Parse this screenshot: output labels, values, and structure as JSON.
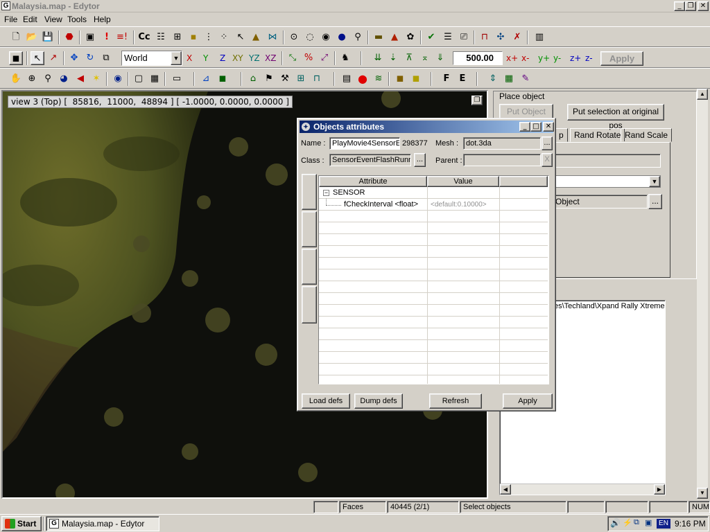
{
  "window": {
    "title": "Malaysia.map - Edytor"
  },
  "menu": [
    "File",
    "Edit",
    "View",
    "Tools",
    "Help"
  ],
  "toolbar1": {
    "cc_label": "Cc",
    "icons": [
      "new-icon",
      "open-icon",
      "save-icon",
      "stop-icon",
      "cube-icon",
      "warning-icon",
      "warning-list-icon",
      "rename-icon",
      "script-icon",
      "script-edit-icon",
      "group-icon",
      "ungroup-icon",
      "ungroup-all-icon",
      "select-arrow-icon",
      "warning-triangle-icon",
      "tree-icon",
      "path-icon",
      "ellipse-icon",
      "eye-icon",
      "eye-solid-icon",
      "pin-icon",
      "book-icon",
      "drop-icon",
      "flower-icon",
      "check-icon",
      "list-icon",
      "camera-icon",
      "gate-icon",
      "tool-icon",
      "tick-icon",
      "film-icon"
    ]
  },
  "toolbar2": {
    "coord_space": "World",
    "axes": [
      "X",
      "Y",
      "Z",
      "XY",
      "YZ",
      "XZ"
    ],
    "step_value": "500.00",
    "step_axes": [
      "x+",
      "x-",
      "y+",
      "y-",
      "z+",
      "z-"
    ],
    "apply_label": "Apply"
  },
  "toolbar3": {
    "letters": [
      "F",
      "E"
    ]
  },
  "viewport": {
    "label": "view 3 (Top) [  85816,  11000,  48894 ] [ -1.0000, 0.0000, 0.0000 ]"
  },
  "right_panel": {
    "group_label": "Place object",
    "put_object": "Put Object",
    "put_selection": "Put selection at original pos",
    "tabs": [
      "p",
      "Rand Rotate",
      "Rand Scale"
    ],
    "object_label": "Object",
    "path_text": "es\\Techland\\Xpand Rally Xtreme"
  },
  "dialog": {
    "title": "Objects attributes",
    "name_label": "Name :",
    "name_value": "PlayMovie4SensorE",
    "name_id": "298377",
    "mesh_label": "Mesh :",
    "mesh_value": "dot.3da",
    "class_label": "Class :",
    "class_value": "SensorEventFlashRunn",
    "parent_label": "Parent :",
    "parent_value": "",
    "browse": "...",
    "clear": "X",
    "columns": [
      "Attribute",
      "Value"
    ],
    "rows": [
      {
        "attr": "SENSOR",
        "value": "",
        "expand": "−"
      },
      {
        "attr": "fCheckInterval <float>",
        "value": "<default:0.10000>"
      }
    ],
    "buttons": {
      "load": "Load defs",
      "dump": "Dump defs",
      "refresh": "Refresh",
      "apply": "Apply"
    }
  },
  "statusbar": {
    "faces_label": "Faces",
    "faces_value": "40445  (2/1)",
    "mode": "Select objects",
    "num": "NUM"
  },
  "taskbar": {
    "start": "Start",
    "task": "Malaysia.map - Edytor",
    "lang": "EN",
    "clock": "9:16 PM"
  },
  "colors": {
    "title_active": "#0a246a",
    "title_gradient_end": "#a6caf0",
    "grass": "#3f4a1b",
    "ground_dark": "#0e0f0c"
  }
}
